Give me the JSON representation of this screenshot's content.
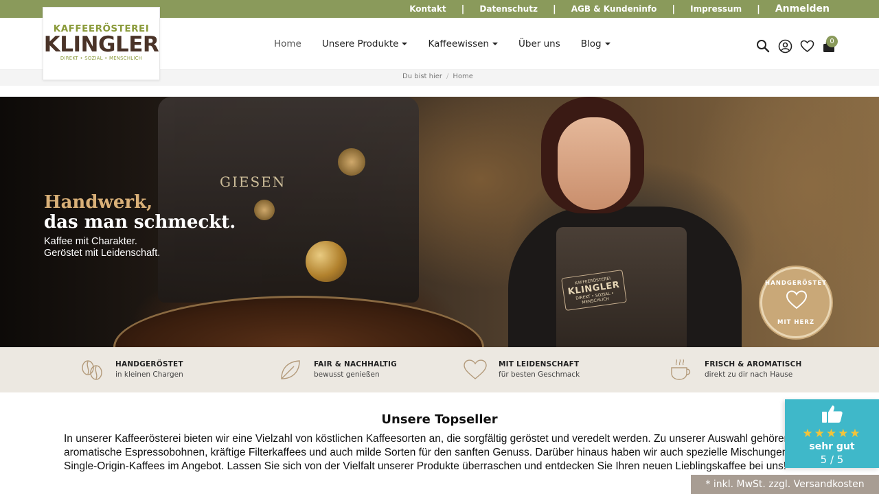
{
  "topbar": {
    "links": [
      "Kontakt",
      "Datenschutz",
      "AGB & Kundeninfo",
      "Impressum"
    ],
    "login": "Anmelden",
    "bg_color": "#8a9a5b"
  },
  "logo": {
    "line1": "KAFFEERÖSTEREI",
    "line2": "KLINGLER",
    "line3": "DIREKT • SOZIAL • MENSCHLICH"
  },
  "nav": {
    "items": [
      {
        "label": "Home",
        "dropdown": false,
        "active": true
      },
      {
        "label": "Unsere Produkte",
        "dropdown": true
      },
      {
        "label": "Kaffeewissen",
        "dropdown": true
      },
      {
        "label": "Über uns",
        "dropdown": false
      },
      {
        "label": "Blog",
        "dropdown": true
      }
    ]
  },
  "header_icons": [
    "search-icon",
    "user-account-icon",
    "wishlist-heart-icon",
    "shopping-bag-icon"
  ],
  "cart": {
    "count": "0"
  },
  "breadcrumb": {
    "prefix": "Du bist hier",
    "current": "Home"
  },
  "hero": {
    "headline_1": "Handwerk,",
    "headline_2": "das man schmeckt.",
    "sub_1": "Kaffee mit Charakter.",
    "sub_2": "Geröstet mit Leidenschaft.",
    "roaster_brand": "GIESEN",
    "apron_top": "KAFFEERÖSTEREI",
    "apron_name": "KLINGLER",
    "apron_bottom": "DIREKT • SOZIAL • MENSCHLICH",
    "stamp_top": "HANDGERÖSTET",
    "stamp_bottom": "MIT HERZ",
    "accent_color": "#d9b078"
  },
  "features": [
    {
      "icon": "coffee-beans-icon",
      "title": "HANDGERÖSTET",
      "subtitle": "in kleinen Chargen"
    },
    {
      "icon": "leaf-icon",
      "title": "FAIR & NACHHALTIG",
      "subtitle": "bewusst genießen"
    },
    {
      "icon": "heart-icon",
      "title": "MIT LEIDENSCHAFT",
      "subtitle": "für besten Geschmack"
    },
    {
      "icon": "coffee-cup-icon",
      "title": "FRISCH & AROMATISCH",
      "subtitle": "direkt zu dir nach Hause"
    }
  ],
  "main": {
    "title": "Unsere Topseller",
    "text": "In unserer Kaffeerösterei bieten wir eine Vielzahl von köstlichen Kaffeesorten an, die sorgfältig geröstet und veredelt werden. Zu unserer Auswahl gehören aromatische Espressobohnen, kräftige Filterkaffees und auch milde Sorten für den sanften Genuss. Darüber hinaus haben wir auch spezielle Mischungen und Single-Origin-Kaffees im Angebot. Lassen Sie sich von der Vielfalt unserer Produkte überraschen und entdecken Sie Ihren neuen Lieblingskaffee bei uns!"
  },
  "rating": {
    "icon": "thumbs-up-icon",
    "stars": "★★★★★",
    "label": "sehr gut",
    "score": "5 / 5",
    "bg_color": "#3fb8c9"
  },
  "tax_note": "* inkl. MwSt. zzgl. Versandkosten"
}
